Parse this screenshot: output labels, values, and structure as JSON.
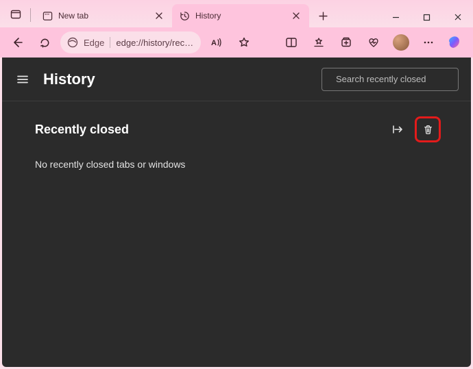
{
  "window": {
    "tabs": [
      {
        "title": "New tab",
        "active": false
      },
      {
        "title": "History",
        "active": true
      }
    ]
  },
  "toolbar": {
    "edge_label": "Edge",
    "url_display": "edge://history/rec…"
  },
  "page": {
    "title": "History",
    "search_placeholder": "Search recently closed",
    "section_title": "Recently closed",
    "empty_message": "No recently closed tabs or windows"
  }
}
